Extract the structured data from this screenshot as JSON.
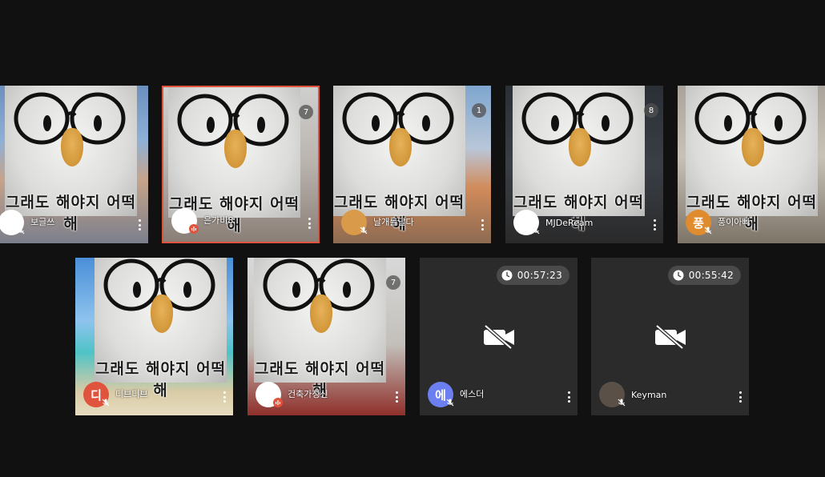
{
  "caption": "그래도 해야지 어떡해",
  "participants": [
    {
      "name": "보글쓰",
      "avatar_text": "",
      "avatar_color": "#ffffff",
      "mic": "muted",
      "background": "sky"
    },
    {
      "name": "은가비8",
      "avatar_text": "",
      "avatar_color": "#ffffff",
      "mic": "active",
      "background": "room",
      "speaking": true,
      "badge": "7"
    },
    {
      "name": "날개를달다",
      "avatar_text": "",
      "avatar_color": "#d99a4a",
      "mic": "muted",
      "background": "desert",
      "badge": "1"
    },
    {
      "name": "MJDeReam",
      "avatar_text": "",
      "avatar_color": "#ffffff",
      "mic": "muted",
      "background": "dark",
      "badge": "8"
    },
    {
      "name": "풍이아빠",
      "avatar_text": "풍",
      "avatar_color": "#e08b2e",
      "mic": "muted",
      "background": "office"
    },
    {
      "name": "디브디브",
      "avatar_text": "디",
      "avatar_color": "#e0533d",
      "mic": "muted",
      "background": "beach"
    },
    {
      "name": "건축가정신",
      "avatar_text": "",
      "avatar_color": "#ffffff",
      "mic": "active",
      "background": "interior",
      "badge": "7"
    },
    {
      "name": "에스더",
      "avatar_text": "에",
      "avatar_color": "#6b7ff0",
      "mic": "muted",
      "camera": "off",
      "timer": "00:57:23"
    },
    {
      "name": "Keyman",
      "avatar_text": "",
      "avatar_color": "#5a5048",
      "mic": "muted",
      "camera": "off",
      "timer": "00:55:42"
    }
  ],
  "icons": {
    "mic_muted": "mic-off-icon",
    "mic_active": "mic-active-icon",
    "camera_off": "video-off-icon",
    "timer": "clock-icon",
    "more": "more-vertical-icon"
  },
  "colors": {
    "page_bg": "#111111",
    "tile_bg": "#2b2b2b",
    "speaking_border": "#e0533d",
    "timer_bg": "#4a4a4a"
  }
}
